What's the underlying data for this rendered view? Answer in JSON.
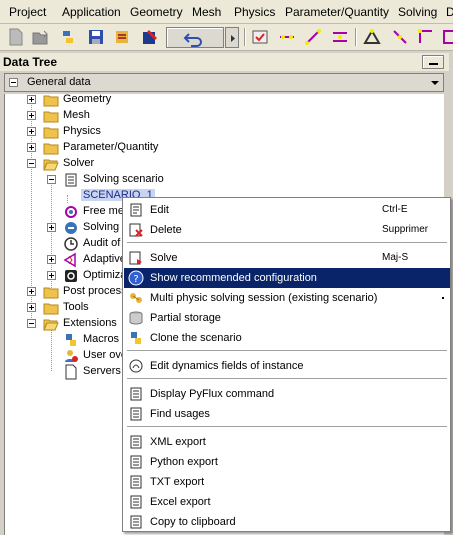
{
  "menubar": {
    "items": [
      "Project",
      "Application",
      "Geometry",
      "Mesh",
      "Physics",
      "Parameter/Quantity",
      "Solving",
      "D"
    ]
  },
  "panel": {
    "title": "Data Tree",
    "combo_value": "General data"
  },
  "tree": {
    "geometry": "Geometry",
    "mesh": "Mesh",
    "physics": "Physics",
    "parameter": "Parameter/Quantity",
    "solver": "Solver",
    "solving_scenario": "Solving scenario",
    "scenario_1": "SCENARIO_1",
    "free_me": "Free me",
    "solving_p": "Solving p",
    "audit_of": "Audit of",
    "adaptive": "Adaptive",
    "optimiza": "Optimiza",
    "post_process": "Post process",
    "tools": "Tools",
    "extensions": "Extensions",
    "macros": "Macros",
    "user_ove": "User ove",
    "servers": "Servers"
  },
  "context_menu": {
    "edit": "Edit",
    "edit_shortcut": "Ctrl-E",
    "delete": "Delete",
    "delete_shortcut": "Supprimer",
    "solve": "Solve",
    "solve_shortcut": "Maj-S",
    "show_recommended": "Show recommended configuration",
    "multi_physic": "Multi physic solving session (existing scenario)",
    "partial_storage": "Partial storage",
    "clone_scenario": "Clone the scenario",
    "edit_dynamics": "Edit dynamics fields of instance",
    "display_pyflux": "Display PyFlux command",
    "find_usages": "Find usages",
    "xml_export": "XML export",
    "python_export": "Python export",
    "txt_export": "TXT export",
    "excel_export": "Excel export",
    "copy_clipboard": "Copy to clipboard"
  },
  "colors": {
    "highlight": "#0a246a",
    "selection": "#c8d4f0",
    "folder": "#f0c24a",
    "chrome": "#ece9d8"
  }
}
